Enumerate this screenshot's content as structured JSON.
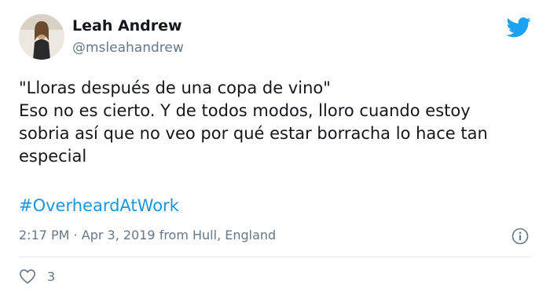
{
  "user": {
    "name": "Leah Andrew",
    "handle": "@msleahandrew"
  },
  "tweet": {
    "lines": [
      "\"Lloras después de una copa de vino\"",
      "Eso no es cierto. Y de todos modos, lloro cuando estoy",
      "sobria así que no veo por qué estar borracha lo hace tan",
      "especial"
    ],
    "hashtag": "#OverheardAtWork",
    "time": "2:17 PM",
    "separator": "·",
    "date": "Apr 3, 2019",
    "location": "from Hull, England",
    "likes": "3"
  },
  "icons": {
    "brand": "twitter-bird-icon",
    "info": "info-icon",
    "like": "heart-icon"
  },
  "colors": {
    "brand": "#1da1f2",
    "hashtag": "#1b95e0",
    "secondary_text": "#657786"
  }
}
